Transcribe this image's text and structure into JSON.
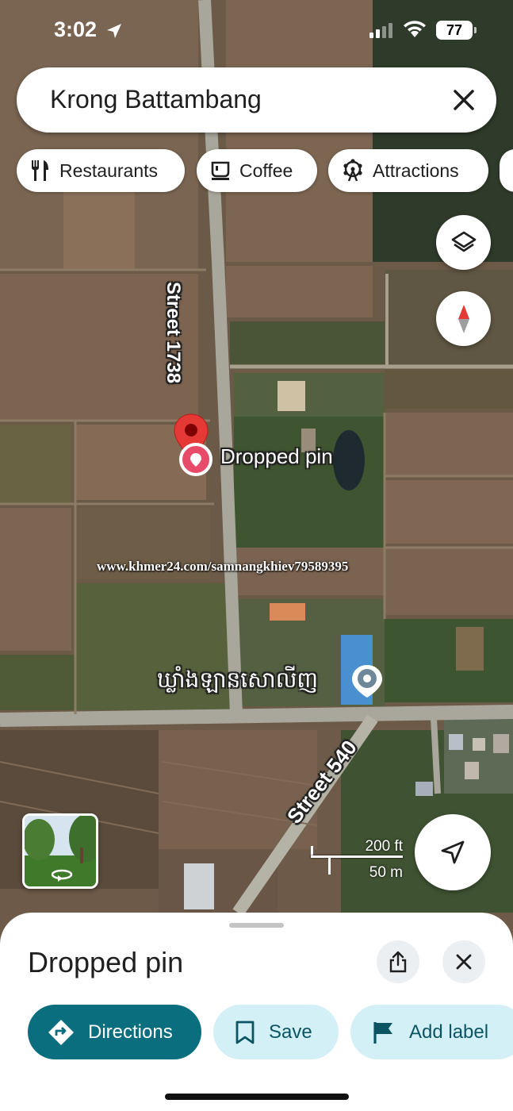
{
  "status_bar": {
    "time": "3:02",
    "battery": "77"
  },
  "search": {
    "query": "Krong Battambang"
  },
  "chips": [
    {
      "label": "Restaurants",
      "icon": "fork-knife-icon"
    },
    {
      "label": "Coffee",
      "icon": "coffee-cup-icon"
    },
    {
      "label": "Attractions",
      "icon": "ferris-wheel-icon"
    }
  ],
  "map": {
    "roads": {
      "street_north": "Street 1738",
      "street_south": "Street 540"
    },
    "dropped_pin_label": "Dropped pin",
    "place_label": "ឃ្លាំងឡានសោលីញ",
    "watermark": "www.khmer24.com/samnangkhiev79589395",
    "scale": {
      "imperial": "200 ft",
      "metric": "50 m"
    }
  },
  "sheet": {
    "title": "Dropped pin",
    "actions": {
      "directions": "Directions",
      "save": "Save",
      "add_label": "Add label"
    }
  },
  "colors": {
    "accent": "#0b6e7f",
    "pin": "#e53935",
    "chip_tonal": "#d3f0f7"
  }
}
